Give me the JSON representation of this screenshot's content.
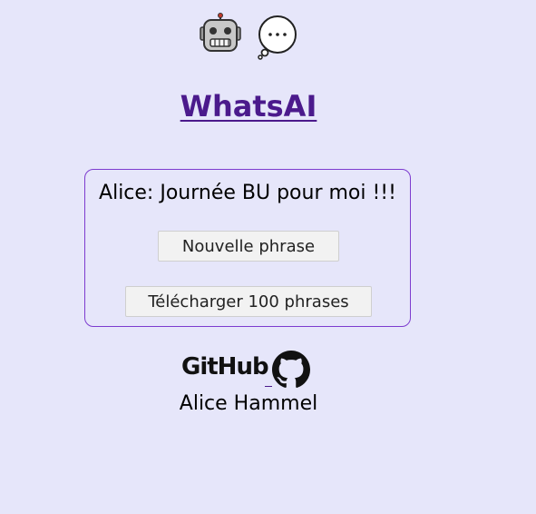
{
  "header": {
    "robot_icon": "robot-icon",
    "bubble_icon": "thought-bubble-icon",
    "title": "WhatsAI"
  },
  "card": {
    "phrase": "Alice: Journée BU pour moi !!!",
    "new_phrase_label": "Nouvelle phrase",
    "download_label": "Télécharger 100 phrases"
  },
  "footer": {
    "github_label": "GitHub",
    "github_icon": "github-icon",
    "author": "Alice Hammel"
  },
  "colors": {
    "background": "#e6e6fa",
    "title": "#4b1a8c",
    "card_border": "#7d3ccf"
  }
}
